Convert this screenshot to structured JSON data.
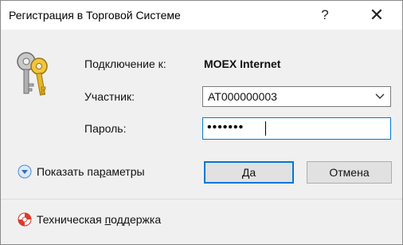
{
  "window": {
    "title": "Регистрация в Торговой Системе",
    "help_label": "?",
    "close_label": "✕"
  },
  "form": {
    "connection_label": "Подключение к:",
    "connection_value": "MOEX Internet",
    "participant_label": "Участник:",
    "participant_value": "AT000000003",
    "password_label": "Пароль:",
    "password_mask": "•••••••"
  },
  "actions": {
    "show_params_pre": "Показать па",
    "show_params_underlined": "р",
    "show_params_post": "аметры",
    "ok_label": "Да",
    "cancel_label": "Отмена"
  },
  "footer": {
    "support_pre": "Техническая ",
    "support_underlined": "п",
    "support_post": "оддержка"
  },
  "icons": {
    "keys": "keys-icon",
    "expand": "chevron-down-circle-icon",
    "support": "lifebuoy-icon",
    "dropdown": "chevron-down-icon"
  },
  "colors": {
    "focus_border": "#0078d7",
    "button_face": "#e1e1e1",
    "dialog_bg": "#f0f0f0"
  }
}
